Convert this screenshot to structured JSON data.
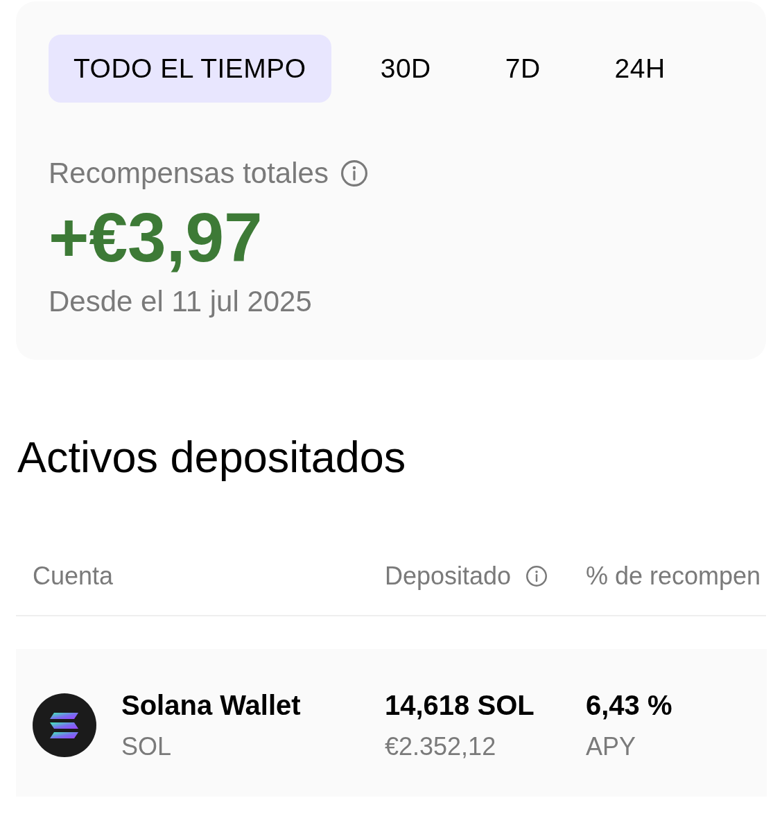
{
  "tabs": [
    {
      "label": "TODO EL TIEMPO",
      "selected": true
    },
    {
      "label": "30D",
      "selected": false
    },
    {
      "label": "7D",
      "selected": false
    },
    {
      "label": "24H",
      "selected": false
    }
  ],
  "rewards": {
    "label": "Recompensas totales",
    "amount": "+€3,97",
    "since": "Desde el 11 jul 2025"
  },
  "deposits": {
    "title": "Activos depositados",
    "columns": [
      {
        "label": "Cuenta",
        "info": false
      },
      {
        "label": "Depositado",
        "info": true
      },
      {
        "label": "% de recompen",
        "info": false
      }
    ],
    "rows": [
      {
        "name": "Solana Wallet",
        "ticker": "SOL",
        "amount": "14,618 SOL",
        "value": "€2.352,12",
        "rate": "6,43 %",
        "rate_label": "APY"
      }
    ]
  }
}
